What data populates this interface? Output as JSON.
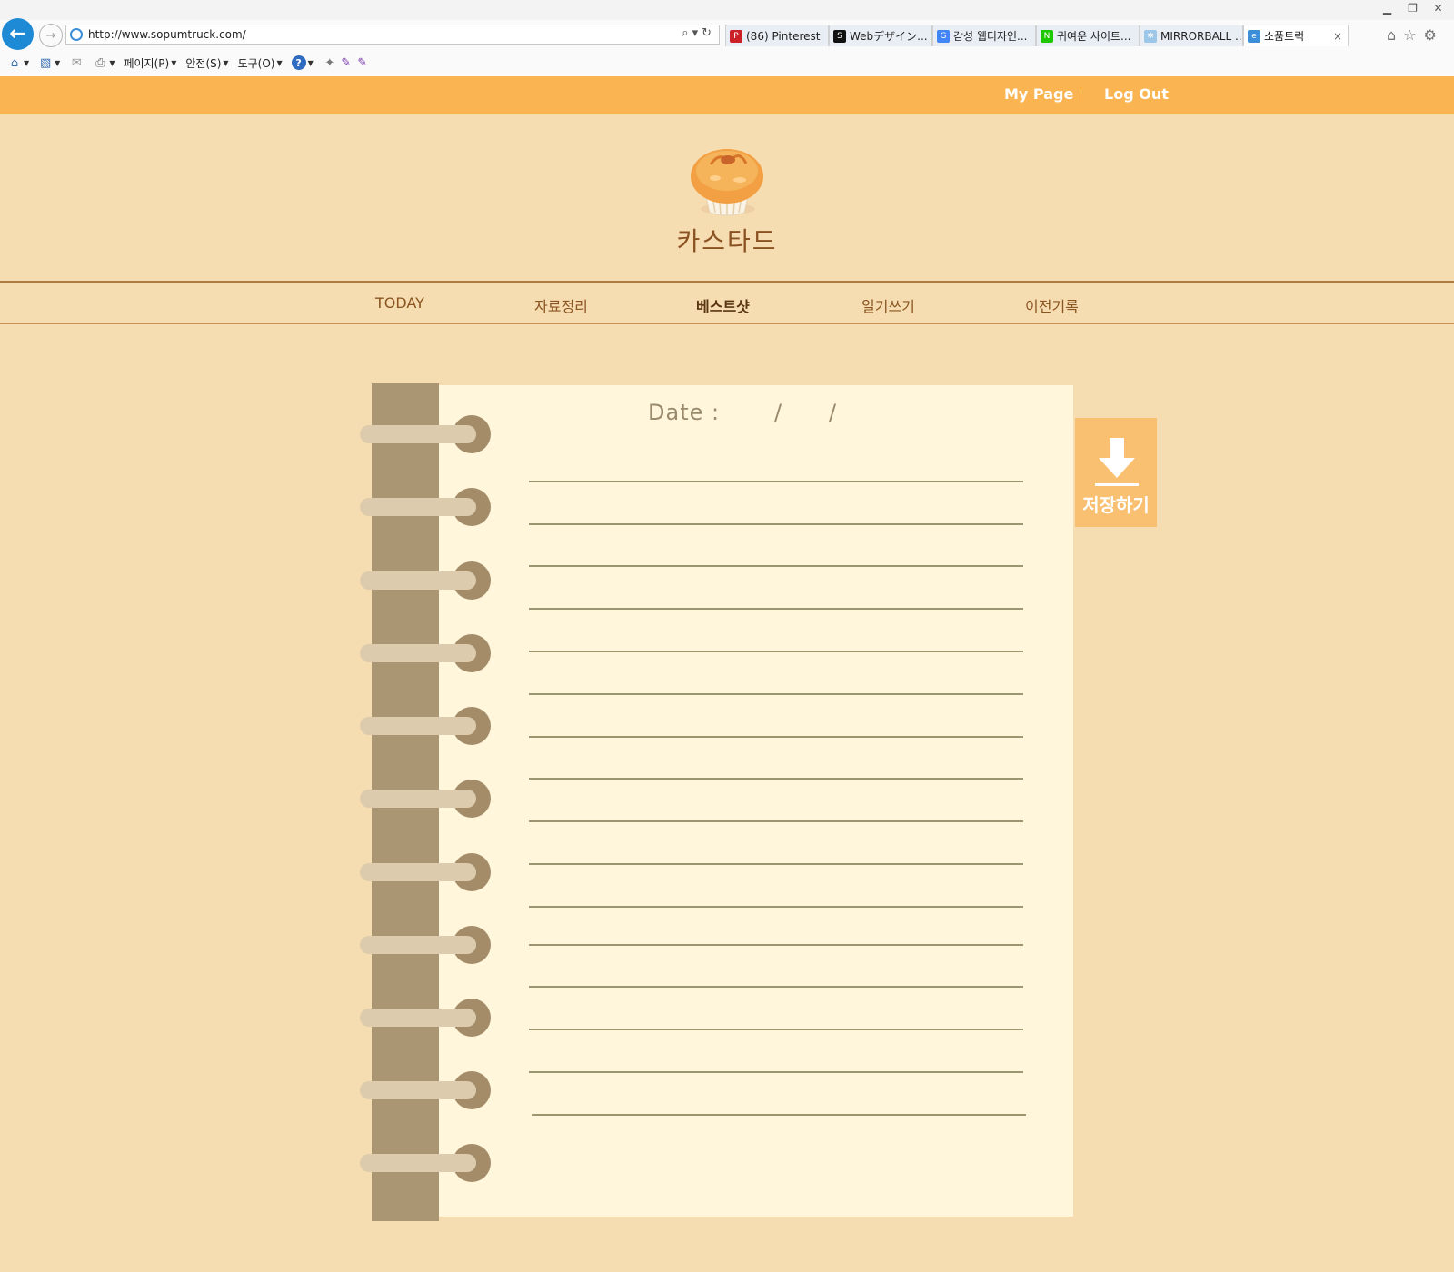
{
  "browser": {
    "url": "http://www.sopumtruck.com/",
    "tabs": [
      {
        "label": "(86) Pinterest",
        "icon": "pinterest-icon",
        "color": "#cb2027",
        "glyph": "P"
      },
      {
        "label": "Webデザイン...",
        "icon": "web-icon",
        "color": "#111111",
        "glyph": "S"
      },
      {
        "label": "감성 웹디자인...",
        "icon": "google-icon",
        "color": "#4285f4",
        "glyph": "G"
      },
      {
        "label": "귀여운 사이트...",
        "icon": "naver-icon",
        "color": "#1ec800",
        "glyph": "N"
      },
      {
        "label": "MIRRORBALL ...",
        "icon": "mirrorball-icon",
        "color": "#9cc7e8",
        "glyph": "✲"
      },
      {
        "label": "소품트럭",
        "icon": "ie-icon",
        "color": "#3c8ed8",
        "glyph": "e"
      }
    ],
    "commands": {
      "page": "페이지(P)",
      "safety": "안전(S)",
      "tools": "도구(O)"
    }
  },
  "site": {
    "top_links": {
      "mypage": "My Page",
      "logout": "Log Out"
    },
    "brand": "카스타드",
    "nav": [
      {
        "label": "TODAY"
      },
      {
        "label": "자료정리"
      },
      {
        "label": "베스트샷"
      },
      {
        "label": "일기쓰기"
      },
      {
        "label": "이전기록"
      }
    ],
    "active_nav": "베스트샷"
  },
  "notebook": {
    "date_label": "Date :",
    "slash1": "/",
    "slash2": "/",
    "save_label": "저장하기"
  },
  "colors": {
    "background": "#f6dcb1",
    "topbar": "#fab452",
    "page": "#fff6dc",
    "spine": "#ab9674",
    "save_button": "#f9c071"
  }
}
